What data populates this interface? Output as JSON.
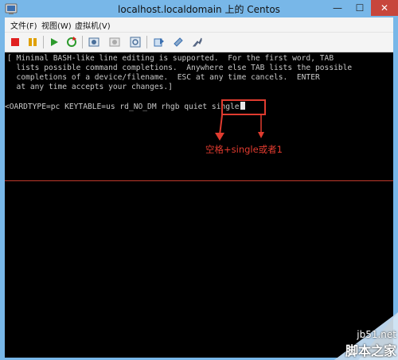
{
  "window": {
    "title": "localhost.localdomain 上的 Centos",
    "controls": {
      "minimize": "—",
      "maximize": "☐",
      "close": "✕"
    }
  },
  "menu": {
    "items": [
      "文件(F)",
      "视图(W)",
      "虚拟机(V)"
    ]
  },
  "toolbar": {
    "buttons": [
      "stop-icon",
      "pause-icon",
      "play-icon",
      "reset-icon",
      "snapshot-icon",
      "snapshot-revert-icon",
      "snapshot-manager-icon",
      "console-send-icon",
      "settings-icon",
      "connect-device-icon"
    ]
  },
  "console": {
    "lines": [
      "[ Minimal BASH-like line editing is supported.  For the first word, TAB",
      "  lists possible command completions.  Anywhere else TAB lists the possible",
      "  completions of a device/filename.  ESC at any time cancels.  ENTER",
      "  at any time accepts your changes.]"
    ],
    "command_prefix": "<OARDTYPE=pc KEYTABLE=us rd_NO_DM rhgb quiet ",
    "command_highlight": "single"
  },
  "annotation": {
    "text": "空格+single或者1",
    "color": "#e23b2f"
  },
  "watermark": {
    "site": "jb51.net",
    "name": "脚本之家"
  }
}
